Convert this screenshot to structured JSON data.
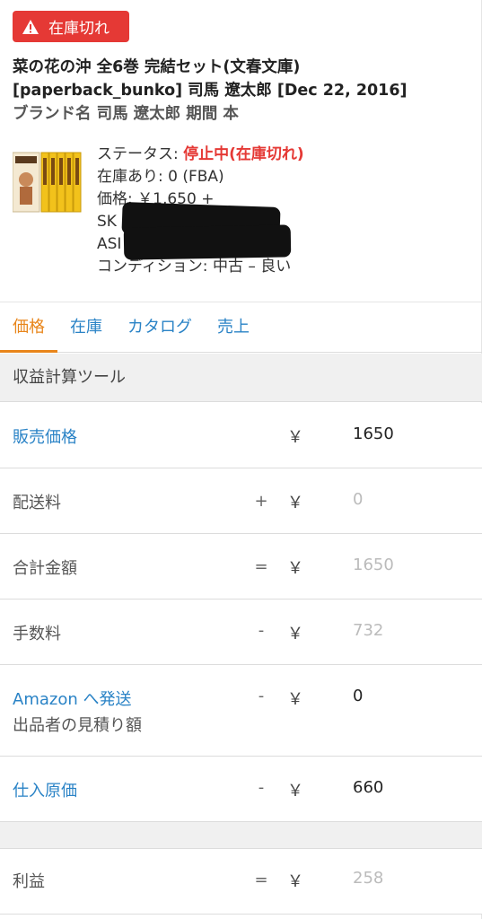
{
  "badge": {
    "label": "在庫切れ"
  },
  "product": {
    "title_line1": "菜の花の沖 全6巻 完結セット(文春文庫)",
    "title_line2": "[paperback_bunko] 司馬 遼太郎 [Dec 22, 2016]",
    "title_line3": "ブランド名 司馬 遼太郎 期間 本"
  },
  "details": {
    "status_label": "ステータス: ",
    "status_value": "停止中(在庫切れ)",
    "stock": "在庫あり: 0 (FBA)",
    "price": "価格: ￥1,650 +",
    "sku": "SK",
    "asin": "ASI",
    "condition": "コンディション: 中古 – 良い"
  },
  "tabs": [
    "価格",
    "在庫",
    "カタログ",
    "売上"
  ],
  "section_title": "収益計算ツール",
  "currency": "￥",
  "rows": {
    "sale_price": {
      "label": "販売価格",
      "op": "",
      "value": "1650"
    },
    "shipping": {
      "label": "配送料",
      "op": "+",
      "value": "0"
    },
    "total": {
      "label": "合計金額",
      "op": "=",
      "value": "1650"
    },
    "fee": {
      "label": "手数料",
      "op": "-",
      "value": "732"
    },
    "amazon_ship": {
      "label": "Amazon へ発送",
      "sub": "出品者の見積り額",
      "op": "-",
      "value": "0"
    },
    "cost": {
      "label": "仕入原価",
      "op": "-",
      "value": "660"
    },
    "profit": {
      "label": "利益",
      "op": "=",
      "value": "258"
    }
  },
  "colors": {
    "accent": "#e8851a",
    "link": "#2a83c6",
    "alert": "#e53935"
  }
}
